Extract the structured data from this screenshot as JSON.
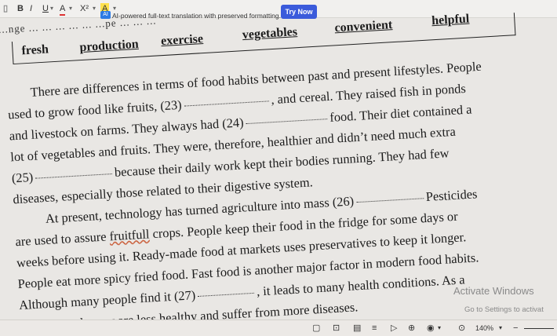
{
  "toolbar": {
    "bold": "B",
    "italic": "I",
    "underline": "U",
    "font_color": "A",
    "superscript": "X²",
    "highlight": "A"
  },
  "ai_banner": {
    "badge": "AI",
    "text": "AI-powered full-text translation with preserved formatting.",
    "try_label": "Try Now"
  },
  "word_box": {
    "cut_text": "...nge ... ... ... ... ... ...pe ... ... ...",
    "words": [
      "fresh",
      "production",
      "exercise",
      "vegetables",
      "convenient",
      "helpful"
    ]
  },
  "paragraphs": [
    {
      "pre": "There are differences in terms of food habits between past and present lifestyles. People",
      "blank": false
    },
    {
      "pre": "used to grow food like fruits, (23)",
      "blank": true,
      "post": ", and cereal. They raised fish in ponds"
    },
    {
      "pre": "and livestock on farms. They always had (24)",
      "blank": true,
      "post": "food. Their diet contained a"
    },
    {
      "pre": "lot of vegetables and fruits. They were, therefore, healthier and didn’t need much extra",
      "blank": false
    },
    {
      "pre": "(25)",
      "blank": true,
      "post": "because their daily work kept their bodies running. They had few"
    },
    {
      "pre": "diseases, especially those related to their digestive system.",
      "blank": false
    },
    {
      "pre": "At present, technology has turned agriculture into mass (26)",
      "blank": true,
      "post": "Pesticides"
    },
    {
      "pre": "are used to assure ",
      "squig": "fruitfull",
      "post2": " crops. People keep their food in the fridge for some days or",
      "blank": false
    },
    {
      "pre": "weeks before using it. Ready-made food at markets uses preservatives to keep it longer.",
      "blank": false
    },
    {
      "pre": "People eat more spicy fried food. Fast food is another major factor in modern food habits.",
      "blank": false
    },
    {
      "pre": "Although many people find it (27)",
      "blank": true,
      "post": ", it leads to many health conditions. As a"
    },
    {
      "pre": "result, people now are less healthy and suffer from more diseases.",
      "blank": false
    }
  ],
  "activate": {
    "title": "Activate Windows",
    "subtitle": "Go to Settings to activat"
  },
  "bottom_bar": {
    "zoom": "140%"
  }
}
